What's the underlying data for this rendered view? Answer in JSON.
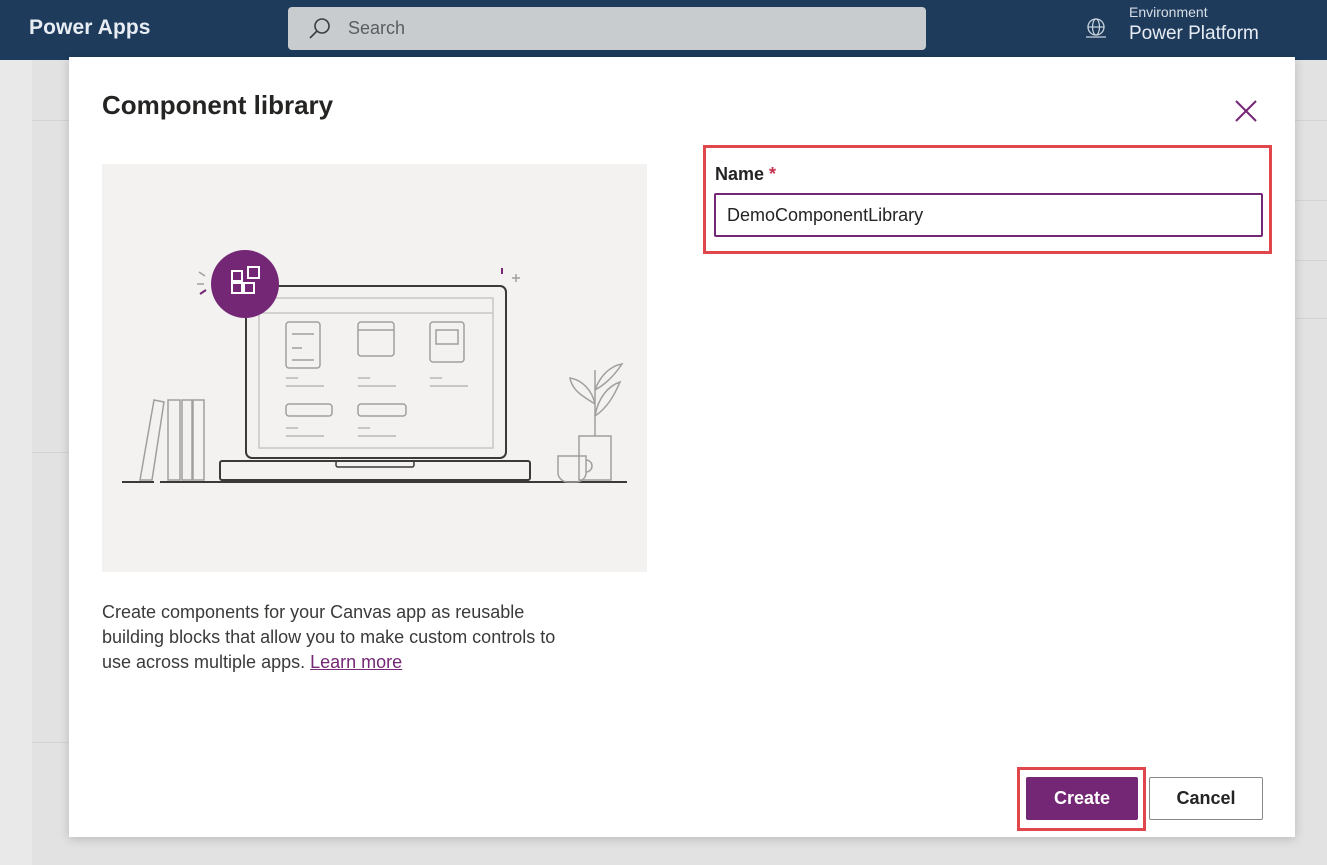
{
  "header": {
    "brand": "Power Apps",
    "search_placeholder": "Search",
    "environment_label": "Environment",
    "environment_value": "Power Platform",
    "search_icon": "search-icon",
    "environment_icon": "globe-icon"
  },
  "dialog": {
    "title": "Component library",
    "close_icon": "close-icon",
    "description": "Create components for your Canvas app as reusable building blocks that allow you to make custom controls to use across multiple apps.",
    "learn_more": "Learn more",
    "name_label": "Name",
    "required_marker": "*",
    "name_value": "DemoComponentLibrary",
    "create_label": "Create",
    "cancel_label": "Cancel"
  },
  "colors": {
    "brand_purple": "#742774",
    "topbar": "#1e3b5c",
    "highlight_red": "#e0474c"
  }
}
